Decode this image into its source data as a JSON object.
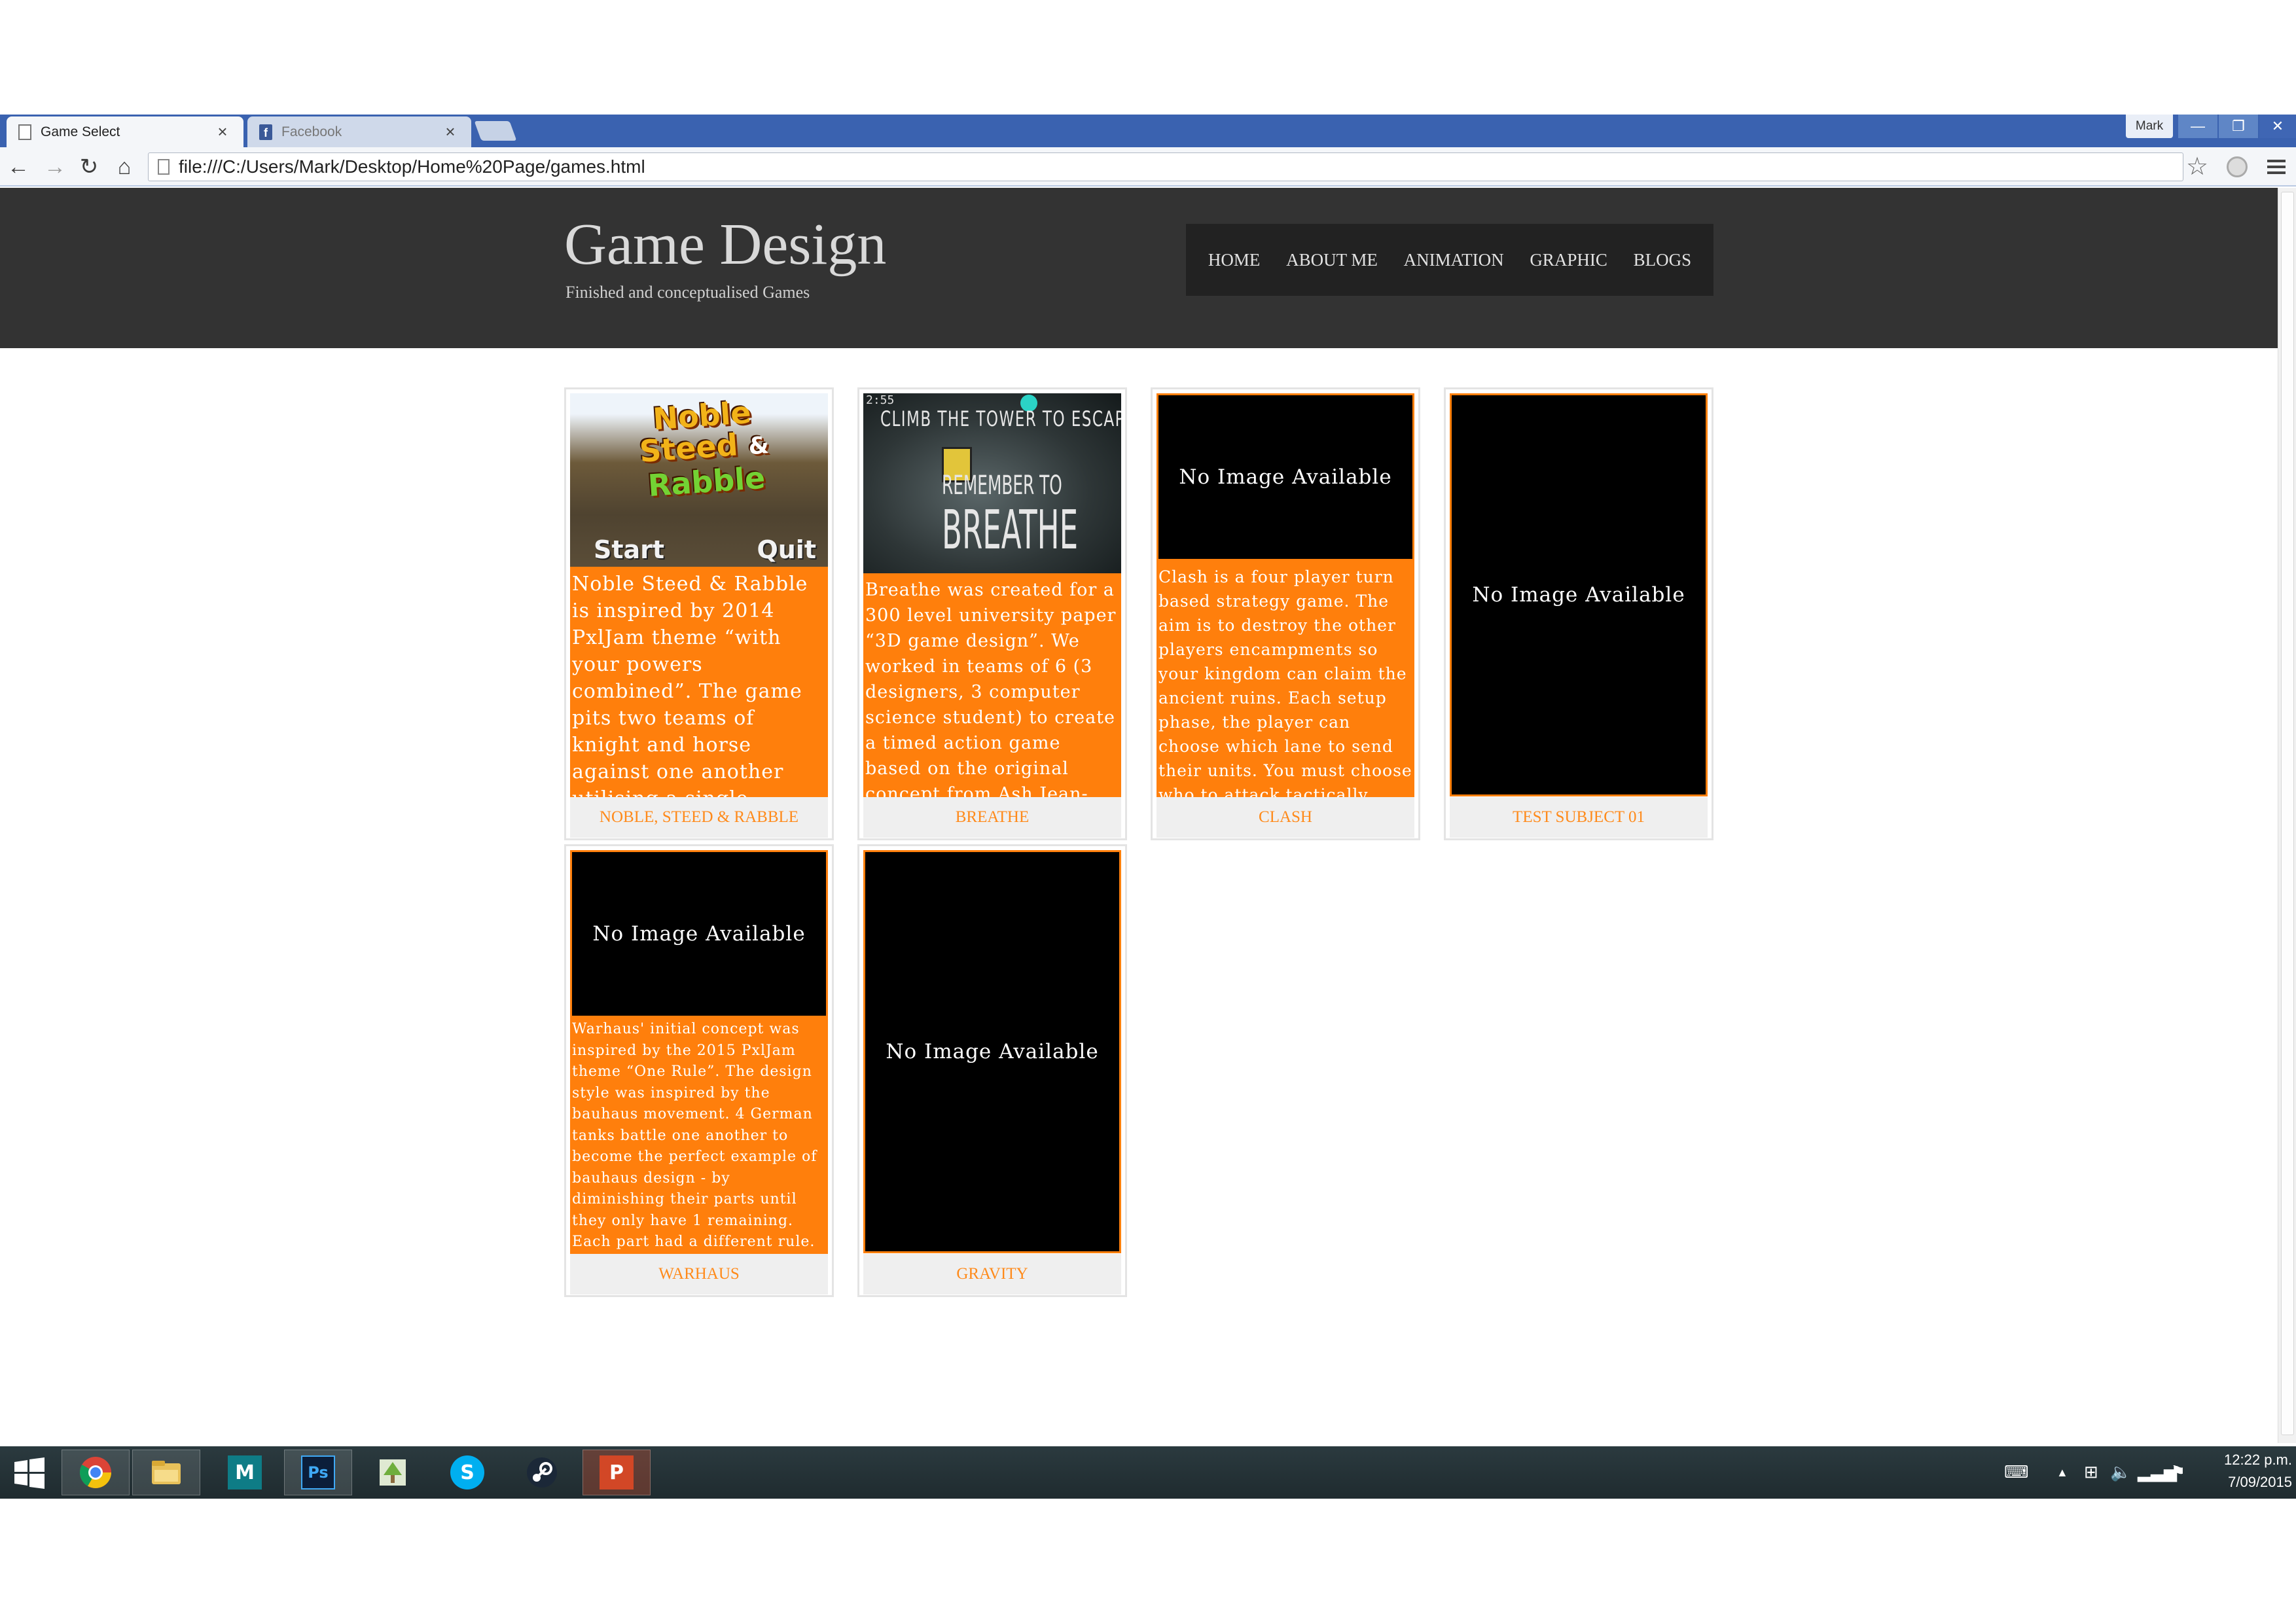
{
  "browser": {
    "tabs": [
      {
        "label": "Game Select",
        "icon": "page-icon"
      },
      {
        "label": "Facebook",
        "icon": "facebook-icon"
      }
    ],
    "user": "Mark",
    "url": "file:///C:/Users/Mark/Desktop/Home%20Page/games.html",
    "window_buttons": {
      "minimize": "—",
      "maximize": "❐",
      "close": "✕"
    }
  },
  "site": {
    "title": "Game Design",
    "subtitle": "Finished and conceptualised Games",
    "nav": [
      "HOME",
      "ABOUT ME",
      "ANIMATION",
      "GRAPHIC",
      "BLOGS"
    ]
  },
  "no_image_text": "No Image Available",
  "games": [
    {
      "name": "NOBLE, STEED & RABBLE",
      "description": "Noble Steed & Rabble is inspired by 2014 PxlJam theme “with your powers combined”. The game pits two teams of knight and horse against one another utilising a single keyboard.",
      "art": {
        "logo_line1": "Noble",
        "logo_line2": "Steed",
        "logo_amp": "&",
        "logo_line3": "Rabble",
        "start": "Start",
        "quit": "Quit"
      }
    },
    {
      "name": "BREATHE",
      "description": "Breathe was created for a 300 level university paper “3D game design”. We worked in teams of 6 (3 designers, 3 computer science student) to create a timed action game based on the original concept from Ash Jean-King.",
      "art": {
        "hud": "2:55",
        "line1": "CLIMB THE TOWER TO ESCAPE",
        "line2": "REMEMBER TO",
        "line3": "BREATHE"
      }
    },
    {
      "name": "CLASH",
      "description": "Clash is a four player turn based strategy game. The aim is to destroy the other players encampments so your kingdom can claim the ancient ruins. Each setup phase, the player can choose which lane to send their units. You must choose who to attack tactically."
    },
    {
      "name": "TEST SUBJECT 01",
      "description": ""
    },
    {
      "name": "WARHAUS",
      "description": "Warhaus' initial concept was inspired by the 2015 PxlJam theme “One Rule”. The design style was inspired by the bauhaus movement. 4 German tanks battle one another to become the perfect example of bauhaus design - by diminishing their parts until they only have 1 remaining. Each part had a different rule."
    },
    {
      "name": "GRAVITY",
      "description": ""
    }
  ],
  "taskbar": {
    "apps": [
      "chrome-icon",
      "file-explorer-icon",
      "maya-icon",
      "photoshop-icon",
      "image-viewer-icon",
      "skype-icon",
      "steam-icon",
      "powerpoint-icon"
    ],
    "app_glyphs": {
      "maya": "M",
      "photoshop": "Ps",
      "skype": "S",
      "powerpoint": "P"
    },
    "time": "12:22 p.m.",
    "date": "7/09/2015"
  },
  "colors": {
    "accent": "#ff7f0c",
    "header_bg": "#333333",
    "nav_bg": "#222222",
    "chrome_blue": "#3a62b0"
  }
}
